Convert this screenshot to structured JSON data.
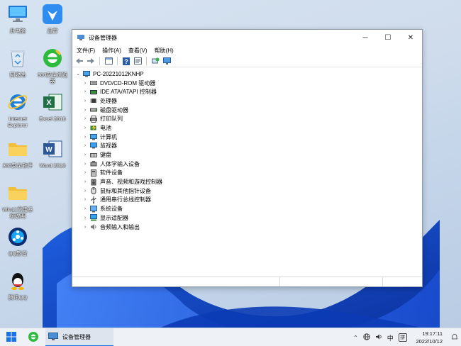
{
  "desktop": {
    "icons": [
      {
        "label": "此电脑",
        "icon": "computer-icon"
      },
      {
        "label": "迅雷",
        "icon": "xunlei-icon"
      },
      {
        "label": "回收站",
        "icon": "recycle-bin-icon"
      },
      {
        "label": "360安全浏览器",
        "icon": "browser-360-icon"
      },
      {
        "label": "Internet Explorer",
        "icon": "ie-icon"
      },
      {
        "label": "Excel 2016",
        "icon": "excel-icon"
      },
      {
        "label": "360安全软件",
        "icon": "folder-icon"
      },
      {
        "label": "Word 2016",
        "icon": "word-icon"
      },
      {
        "label": "Win11常用系统说明",
        "icon": "folder-icon"
      },
      {
        "label": "QQ影音",
        "icon": "qq-player-icon"
      },
      {
        "label": "腾讯QQ",
        "icon": "qq-icon"
      }
    ]
  },
  "window": {
    "title": "设备管理器",
    "menu": [
      "文件(F)",
      "操作(A)",
      "查看(V)",
      "帮助(H)"
    ],
    "root": "PC-20221012KNHP",
    "devices": [
      {
        "label": "DVD/CD-ROM 驱动器",
        "icon": "dvd-drive-icon"
      },
      {
        "label": "IDE ATA/ATAPI 控制器",
        "icon": "ide-controller-icon"
      },
      {
        "label": "处理器",
        "icon": "processor-icon"
      },
      {
        "label": "磁盘驱动器",
        "icon": "disk-drive-icon"
      },
      {
        "label": "打印队列",
        "icon": "printer-icon"
      },
      {
        "label": "电池",
        "icon": "battery-icon"
      },
      {
        "label": "计算机",
        "icon": "computer-icon"
      },
      {
        "label": "监视器",
        "icon": "monitor-icon"
      },
      {
        "label": "键盘",
        "icon": "keyboard-icon"
      },
      {
        "label": "人体学输入设备",
        "icon": "hid-icon"
      },
      {
        "label": "软件设备",
        "icon": "software-device-icon"
      },
      {
        "label": "声音、视频和游戏控制器",
        "icon": "sound-icon"
      },
      {
        "label": "鼠标和其他指针设备",
        "icon": "mouse-icon"
      },
      {
        "label": "通用串行总线控制器",
        "icon": "usb-icon"
      },
      {
        "label": "系统设备",
        "icon": "system-device-icon"
      },
      {
        "label": "显示适配器",
        "icon": "display-adapter-icon"
      },
      {
        "label": "音频输入和输出",
        "icon": "audio-io-icon"
      }
    ]
  },
  "taskbar": {
    "active_app": "设备管理器",
    "ime": "中",
    "ime_mode": "拼",
    "time": "19:17:11",
    "date": "2022/10/12"
  }
}
